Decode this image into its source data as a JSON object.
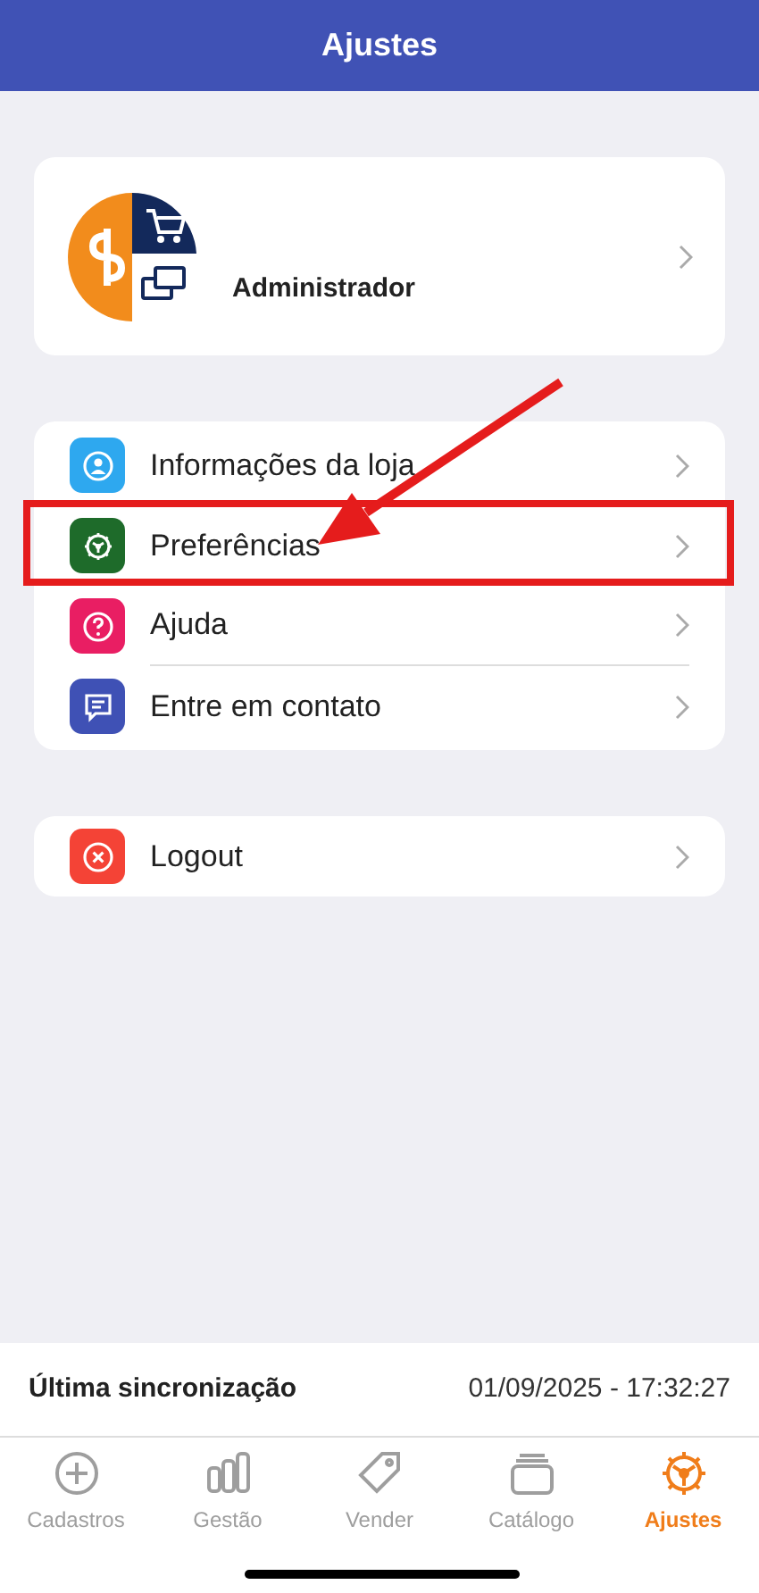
{
  "header": {
    "title": "Ajustes"
  },
  "profile": {
    "role": "Administrador"
  },
  "menu": [
    {
      "kind": "store",
      "label": "Informações da loja",
      "color": "#2ea8ef"
    },
    {
      "kind": "gear",
      "label": "Preferências",
      "color": "#1e6b2a"
    },
    {
      "kind": "help",
      "label": "Ajuda",
      "color": "#e91e63"
    },
    {
      "kind": "chat",
      "label": "Entre em contato",
      "color": "#3f51b5"
    }
  ],
  "logout": [
    {
      "kind": "logout",
      "label": "Logout",
      "color": "#f44336"
    }
  ],
  "sync": {
    "label": "Última sincronização",
    "value": "01/09/2025 - 17:32:27"
  },
  "tabs": [
    {
      "kind": "plus",
      "label": "Cadastros",
      "selected": false
    },
    {
      "kind": "bars",
      "label": "Gestão",
      "selected": false
    },
    {
      "kind": "tag",
      "label": "Vender",
      "selected": false
    },
    {
      "kind": "stack",
      "label": "Catálogo",
      "selected": false
    },
    {
      "kind": "gear",
      "label": "Ajustes",
      "selected": true
    }
  ]
}
